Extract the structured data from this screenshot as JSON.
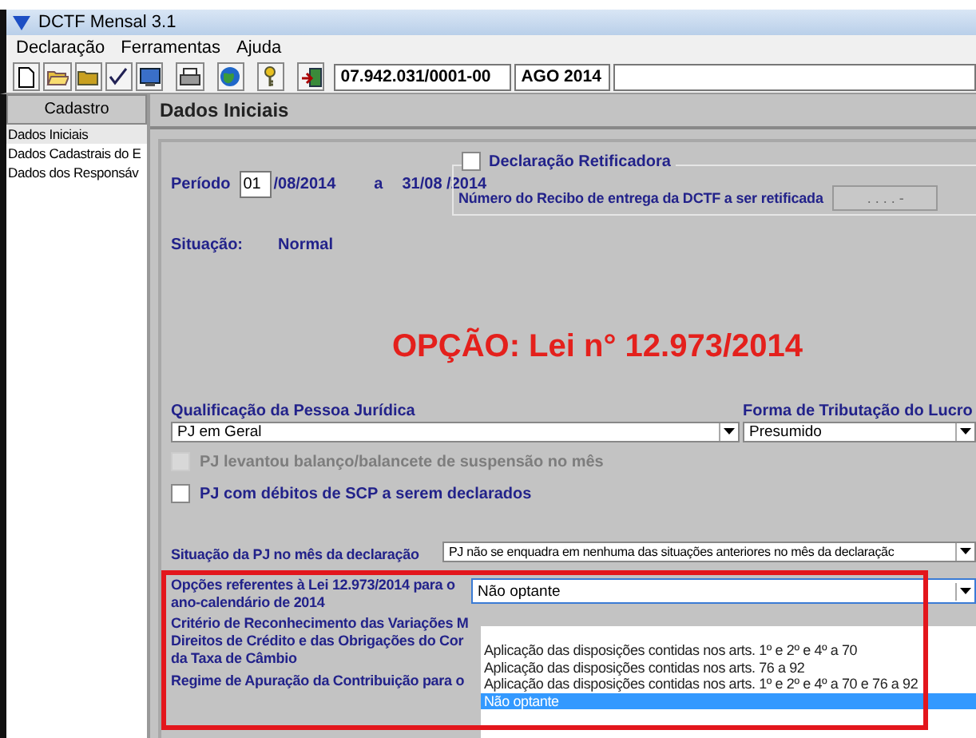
{
  "window": {
    "title": "DCTF Mensal 3.1"
  },
  "menu": [
    "Declaração",
    "Ferramentas",
    "Ajuda"
  ],
  "toolbar": {
    "cnpj": "07.942.031/0001-00",
    "month": "AGO 2014"
  },
  "sidebar": {
    "header": "Cadastro",
    "items": [
      {
        "label": "Dados Iniciais",
        "selected": true
      },
      {
        "label": "Dados Cadastrais do E",
        "selected": false
      },
      {
        "label": "Dados dos Responsáv",
        "selected": false
      }
    ]
  },
  "panel": {
    "title": "Dados Iniciais",
    "period": {
      "label": "Período",
      "day": "01",
      "start_rest": "/08/2014",
      "separator": "a",
      "end": "31/08 /2014"
    },
    "retificadora": {
      "label": "Declaração Retificadora",
      "checked": false,
      "receipt_label": "Número do Recibo de entrega da DCTF a ser retificada",
      "receipt_value": ". . . . -"
    },
    "situacao": {
      "label": "Situação:",
      "value": "Normal"
    },
    "annotation": "OPÇÃO: Lei n° 12.973/2014",
    "qualificacao": {
      "label": "Qualificação da Pessoa Jurídica",
      "value": "PJ em Geral"
    },
    "tributacao": {
      "label": "Forma de Tributação do Lucro",
      "value": "Presumido"
    },
    "checkboxes": [
      {
        "label": "PJ levantou balanço/balancete de suspensão no mês",
        "checked": false,
        "disabled": true
      },
      {
        "label": "PJ com débitos de SCP a serem declarados",
        "checked": false,
        "disabled": false
      }
    ],
    "situacao_pj": {
      "label": "Situação da PJ no mês da declaração",
      "value": "PJ não se enquadra em nenhuma das situações anteriores no mês da declaraçãc"
    },
    "opcoes": {
      "label": "Opções referentes à Lei 12.973/2014 para o ano-calendário de 2014",
      "value": "Não optante",
      "expanded": true,
      "options": [
        {
          "label": "Aplicação das disposições contidas nos arts. 1º e 2º e 4º a 70",
          "selected": false
        },
        {
          "label": "Aplicação das disposições contidas nos arts. 76 a 92",
          "selected": false
        },
        {
          "label": "Aplicação das disposições contidas nos arts. 1º e 2º e 4º a 70 e 76 a 92",
          "selected": false
        },
        {
          "label": "Não optante",
          "selected": true
        }
      ]
    },
    "criterio": {
      "lines": [
        "Critério de Reconhecimento das Variações M",
        "Direitos de Crédito e das Obrigações do Cor",
        "da Taxa de Câmbio"
      ]
    },
    "regime": {
      "label": "Regime de Apuração da Contribuição para o"
    }
  }
}
